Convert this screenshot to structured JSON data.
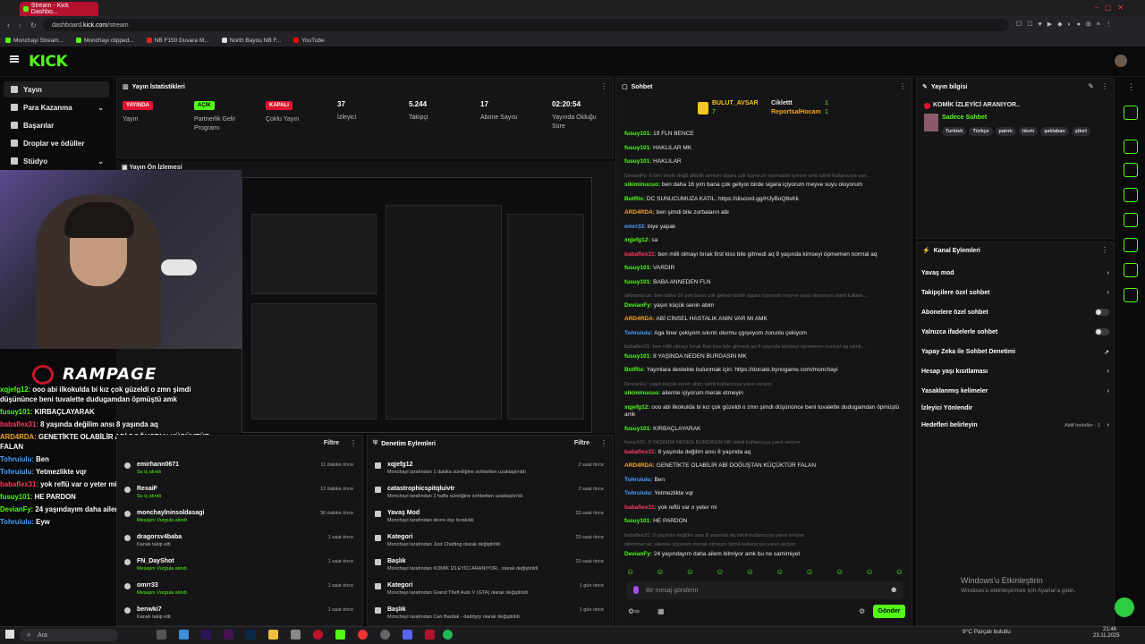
{
  "browser": {
    "tab_title": "Stream - Kick Dashbo...",
    "url_prefix": "dashboard.",
    "url_domain": "kick.com",
    "url_path": "/stream",
    "bookmarks": [
      "Monchayi Stream...",
      "Monchayi clipped...",
      "NB F150 Duvara M...",
      "North Bayou NB F...",
      "YouTube"
    ]
  },
  "kick": {
    "logo": "KICK"
  },
  "sidebar": {
    "items": [
      {
        "label": "Yayın",
        "active": true
      },
      {
        "label": "Para Kazanma"
      },
      {
        "label": "Başarılar"
      },
      {
        "label": "Droplar ve ödüller"
      },
      {
        "label": "Stüdyo"
      }
    ]
  },
  "stats": {
    "title": "Yayın İstatistikleri",
    "items": [
      {
        "value": "YAYINDA",
        "label": "Yayın",
        "badge_color": "#e0132e"
      },
      {
        "value": "AÇIK",
        "label": "Partnerlik Gelir Programı",
        "badge_color": "#53fc18"
      },
      {
        "value": "KAPALI",
        "label": "Çoklu Yayın",
        "badge_color": "#e0132e"
      },
      {
        "value": "37",
        "label": "İzleyici"
      },
      {
        "value": "5.244",
        "label": "Takipçi"
      },
      {
        "value": "17",
        "label": "Abone Sayısı"
      },
      {
        "value": "02:20:54",
        "label": "Yayında Olduğu Süre"
      }
    ]
  },
  "preview": {
    "title": "Yayın Ön İzlemesi"
  },
  "overlay": {
    "brand": "RAMPAGE",
    "chat": [
      {
        "user": "xqjefg12:",
        "text": " ooo abi ilkokulda bi kız çok güzeldi o zmn şimdi düşününce beni tuvalette dudugamdan öpmüştü amk",
        "color": "#53fc18"
      },
      {
        "user": "fusuy101:",
        "text": " KIRBAÇLAYARAK",
        "color": "#53fc18"
      },
      {
        "user": "babaflex31:",
        "text": " 8 yaşında değilim ansı 8 yaşında aq",
        "color": "#ff3b5c"
      },
      {
        "user": "ARD4RDA:",
        "text": " GENETİKTE OLABİLİR ABİ DOĞUŞTAN KÜÇÜKTÜR FALAN",
        "color": "#f5a623"
      },
      {
        "user": "Tohruiulu:",
        "text": " Ben",
        "color": "#4aa3ff"
      },
      {
        "user": "Tohruiulu:",
        "text": " Yetmezlikte vqr",
        "color": "#4aa3ff"
      },
      {
        "user": "babaflex31:",
        "text": " yok reflü var o yeter mi",
        "color": "#ff3b5c"
      },
      {
        "user": "fusuy101:",
        "text": " HE PARDON",
        "color": "#53fc18"
      },
      {
        "user": "DevianFy:",
        "text": " 24 yaşındayım daha ailem bilmiyor amk bu ne samimiyet",
        "color": "#53fc18"
      },
      {
        "user": "Tohruiulu:",
        "text": " Eyw",
        "color": "#4aa3ff"
      }
    ]
  },
  "followers": {
    "filter": "Filtre",
    "rows": [
      {
        "name": "emirhann0671",
        "sub": "Su iç alındı",
        "time": "11 dakika önce"
      },
      {
        "name": "RexaiF",
        "sub": "Su iç alındı",
        "time": "12 dakika önce"
      },
      {
        "name": "monchaylninsoldasagi",
        "sub": "Mesajını Vurgula alındı",
        "time": "36 dakika önce"
      },
      {
        "name": "dragorsv4baba",
        "sub": "Kanalı takip etti",
        "time": "1 saat önce"
      },
      {
        "name": "FN_DayShot",
        "sub": "Mesajını Vurgula alındı",
        "time": "1 saat önce"
      },
      {
        "name": "omrr33",
        "sub": "Mesajını Vurgula alındı",
        "time": "1 saat önce"
      },
      {
        "name": "benwki7",
        "sub": "Kanalı takip etti",
        "time": "1 saat önce"
      }
    ]
  },
  "moderation": {
    "title": "Denetim Eylemleri",
    "filter": "Filtre",
    "rows": [
      {
        "name": "xqjefg12",
        "sub": "Monchayi tarafından 1 dakika süreliğine sohbetten uzaklaştırıldı",
        "time": "2 saat önce"
      },
      {
        "name": "catastrophicspitqluivtr",
        "sub": "Monchayi tarafından 1 hafta süreliğine sohbetten uzaklaştırıldı",
        "time": "2 saat önce"
      },
      {
        "name": "Yavaş Mod",
        "sub": "Monchayi tarafından devre dışı bırakıldı",
        "time": "23 saat önce"
      },
      {
        "name": "Kategori",
        "sub": "Monchayi tarafından Just Chatting olarak değiştirildi",
        "time": "23 saat önce"
      },
      {
        "name": "Başlık",
        "sub": "Monchayi tarafından KOMİK İZLEYİCİ ARANIYOR.. olarak değiştirildi",
        "time": "23 saat önce"
      },
      {
        "name": "Kategori",
        "sub": "Monchayi tarafından Grand Theft Auto V (GTA) olarak değiştirildi",
        "time": "1 gün önce"
      },
      {
        "name": "Başlık",
        "sub": "Monchayi tarafından Can Bardak - daddyrp olarak değiştirildi",
        "time": "1 gün önce"
      }
    ]
  },
  "chat": {
    "title": "Sohbet",
    "leaders": [
      {
        "name": "BULUT_AVSAR",
        "count": "7"
      },
      {
        "name": "Ciklettt",
        "count": "1"
      },
      {
        "name": "ReportsalHocam",
        "count": "1"
      }
    ],
    "messages": [
      {
        "user": "fusuy101:",
        "text": " 19 FLN BENCE",
        "color": "#53fc18"
      },
      {
        "user": "fusuy101:",
        "text": " HAKLILAR MK",
        "color": "#53fc18"
      },
      {
        "user": "fusuy101:",
        "text": " HAKLILAR",
        "color": "#53fc18"
      },
      {
        "user": "",
        "text": "DevianFy: 6 birs böyle değil alkolik alırken sigara çok içiyorum normalde içmem amk isimli kullanıcıya yan...",
        "color": "",
        "dim": true
      },
      {
        "user": "sikiminucuo:",
        "text": " ben daha 16 yım bana çok geliyor birde sigara içiyorum meyve suyu oluyorum",
        "color": "#53fc18"
      },
      {
        "user": "BotRix:",
        "text": " DC SUNUCUMUZA KATIL: https://discord.gg/HJyBoQ8sKk",
        "color": "#53fc18"
      },
      {
        "user": "ARD4RDA:",
        "text": " ben şimdi bile zorbaların abi",
        "color": "#f5a623"
      },
      {
        "user": "omrr33:",
        "text": " biye yapak",
        "color": "#4aa3ff"
      },
      {
        "user": "xqjefg12:",
        "text": " sa",
        "color": "#53fc18"
      },
      {
        "user": "babaflex31:",
        "text": " ben milli olmayı bırak first kiss bile gitmedi aq 8 yaşında kimseyi öpmemen normal aq",
        "color": "#ff3b5c"
      },
      {
        "user": "fusuy101:",
        "text": " VARDIR",
        "color": "#53fc18"
      },
      {
        "user": "fusuy101:",
        "text": " BABA ANNEDEN FLN",
        "color": "#53fc18"
      },
      {
        "user": "",
        "text": "sikiminucuo: ben daha 16 yım bana çok geliyor birde sigara içiyorum meyve suyu oluyorum isimli kullanı...",
        "color": "",
        "dim": true
      },
      {
        "user": "DevianFy:",
        "text": " yaşın küçük senin abim",
        "color": "#53fc18"
      },
      {
        "user": "ARD4RDA:",
        "text": " ABİ CİNSEL HASTALIK ANIN VAR MI AMK",
        "color": "#f5a623"
      },
      {
        "user": "Tohruiulu:",
        "text": " Aga tiner çekiyom sıkıntı olurmu çgışeyom zorunlu çekiyom",
        "color": "#4aa3ff"
      },
      {
        "user": "",
        "text": "babaflex31: ben milli olmayı bırak first kiss bile gitmedi aq 8 yaşında kimseyi öpmemen normal aq isimli...",
        "color": "",
        "dim": true
      },
      {
        "user": "fusuy101:",
        "text": " 8 YAŞINDA NEDEN BURDASIN MK",
        "color": "#53fc18"
      },
      {
        "user": "BotRix:",
        "text": " Yayınlara destekte bulunmak için: https://donate.bynogame.com/monchayi",
        "color": "#53fc18"
      },
      {
        "user": "",
        "text": "DevianFy: yaşın küçük senin abim isimli kullanıcıya yanıt veriyor",
        "color": "",
        "dim": true
      },
      {
        "user": "sikiminucuo:",
        "text": " ailemle içiyorum merak etmeyin",
        "color": "#53fc18"
      },
      {
        "user": "xqjefg12:",
        "text": " ooo abi ilkokulda bi kız çok güzeldi o zmn şimdi düşününce beni tuvalette dudugamdan öpmüştü amk",
        "color": "#53fc18"
      },
      {
        "user": "fusuy101:",
        "text": " KIRBAÇLAYARAK",
        "color": "#53fc18"
      },
      {
        "user": "",
        "text": "fusuy101: 8 YAŞINDA NEDEN BURDASIN MK isimli kullanıcıya yanıt veriyor",
        "color": "",
        "dim": true
      },
      {
        "user": "babaflex31:",
        "text": " 8 yaşında değilim ansı 8 yaşında aq",
        "color": "#ff3b5c"
      },
      {
        "user": "ARD4RDA:",
        "text": " GENETİKTE OLABİLİR ABİ DOĞUŞTAN KÜÇÜKTÜR FALAN",
        "color": "#f5a623"
      },
      {
        "user": "Tohruiulu:",
        "text": " Ben",
        "color": "#4aa3ff"
      },
      {
        "user": "Tohruiulu:",
        "text": " Yetmezlikte vqr",
        "color": "#4aa3ff"
      },
      {
        "user": "babaflex31:",
        "text": " yok reflü var o yeter mi",
        "color": "#ff3b5c"
      },
      {
        "user": "fusuy101:",
        "text": " HE PARDON",
        "color": "#53fc18"
      },
      {
        "user": "",
        "text": "babaflex31: 8 yaşında değilim ansı 8 yaşında aq isimli kullanıcıya yanıt veriyor",
        "color": "",
        "dim": true
      },
      {
        "user": "",
        "text": "sikiminucuo: ailemle içiyorum merak etmeyin isimli kullanıcıya yanıt veriyor",
        "color": "",
        "dim": true
      },
      {
        "user": "DevianFy:",
        "text": " 24 yaşındayım daha ailem bilmiyor amk bu ne samimiyet",
        "color": "#53fc18"
      },
      {
        "user": "Tohruiulu:",
        "text": " Eyw",
        "color": "#4aa3ff"
      }
    ],
    "input_placeholder": "Bir mesaj gönderin",
    "send_label": "Gönder"
  },
  "streaminfo": {
    "title": "Yayın bilgisi",
    "stream_title": "KOMİK İZLEYİCİ ARANIYOR..",
    "category": "Sadece Sohbet",
    "tags": [
      "Turkish",
      "Türkçe",
      "patrıtı",
      "tıkırtı",
      "şaklaban",
      "şikırt"
    ]
  },
  "actions": {
    "title": "Kanal Eylemleri",
    "items": [
      {
        "label": "Yavaş mod",
        "control": "chevron"
      },
      {
        "label": "Takipçilere özel sohbet",
        "control": "chevron"
      },
      {
        "label": "Abonelere özel sohbet",
        "control": "toggle"
      },
      {
        "label": "Yalnızca ifadelerle sohbet",
        "control": "toggle"
      },
      {
        "label": "Yapay Zeka ile Sohbet Denetimi",
        "control": "link"
      },
      {
        "label": "Hesap yaşı kısıtlaması",
        "control": "chevron"
      },
      {
        "label": "Yasaklanmış kelimeler",
        "control": "chevron"
      },
      {
        "label": "İzleyici Yönlendir",
        "control": "none"
      },
      {
        "label": "Hedefleri belirleyin",
        "control": "chevron",
        "note": "Aktif hedefler - 1"
      }
    ]
  },
  "windows": {
    "search": "Ara",
    "weather": "9°C Parçalı bulutlu",
    "time": "21:46",
    "date": "23.11.2025",
    "watermark_title": "Windows'u Etkinleştirin",
    "watermark_sub": "Windows'u etkinleştirmek için Ayarlar'a gidin."
  }
}
